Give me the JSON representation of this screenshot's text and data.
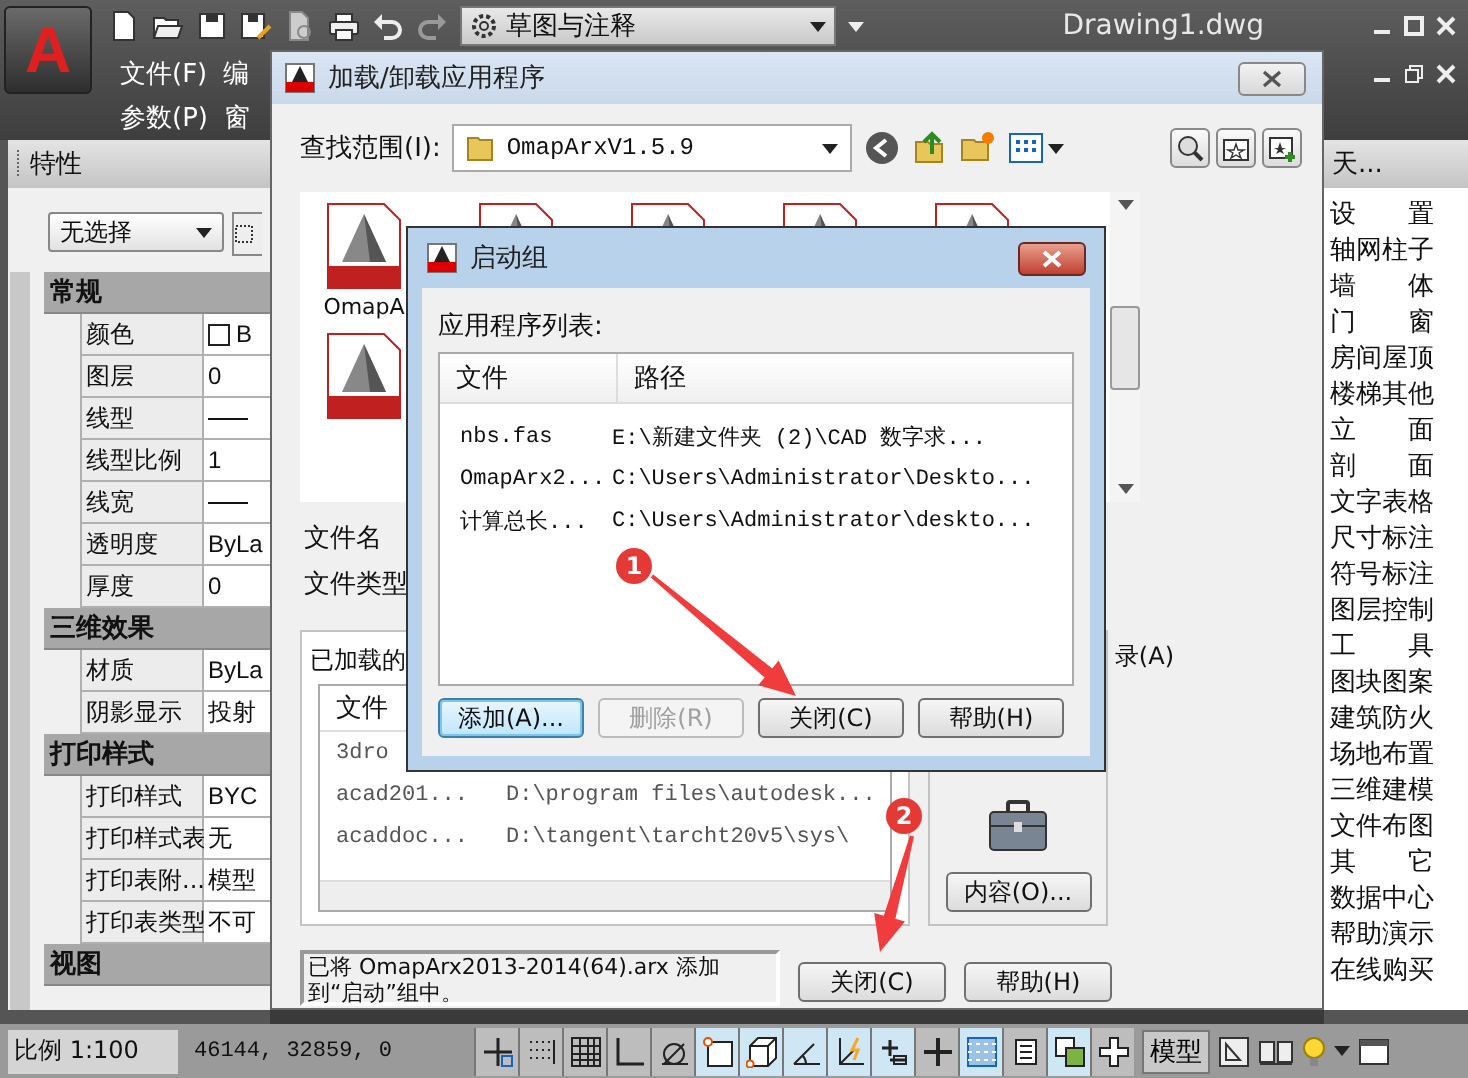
{
  "app": {
    "logo": "A",
    "title": "Drawing1.dwg",
    "workspace": "草图与注释",
    "menus": [
      [
        "文件(F)",
        "编"
      ],
      [
        "参数(P)",
        "窗"
      ]
    ]
  },
  "properties": {
    "title": "特性",
    "selection": "无选择",
    "sections": [
      {
        "title": "常规",
        "rows": [
          {
            "name": "颜色",
            "kind": "color",
            "value": "B"
          },
          {
            "name": "图层",
            "kind": "text",
            "value": "0"
          },
          {
            "name": "线型",
            "kind": "line"
          },
          {
            "name": "线型比例",
            "kind": "text",
            "value": "1"
          },
          {
            "name": "线宽",
            "kind": "line"
          },
          {
            "name": "透明度",
            "kind": "text",
            "value": "ByLa"
          },
          {
            "name": "厚度",
            "kind": "text",
            "value": "0"
          }
        ]
      },
      {
        "title": "三维效果",
        "rows": [
          {
            "name": "材质",
            "kind": "text",
            "value": "ByLa"
          },
          {
            "name": "阴影显示",
            "kind": "text",
            "value": "投射"
          }
        ]
      },
      {
        "title": "打印样式",
        "rows": [
          {
            "name": "打印样式",
            "kind": "text",
            "value": "BYC"
          },
          {
            "name": "打印样式表",
            "kind": "text",
            "value": "无"
          },
          {
            "name": "打印表附...",
            "kind": "text",
            "value": "模型"
          },
          {
            "name": "打印表类型",
            "kind": "text",
            "value": "不可"
          }
        ]
      },
      {
        "title": "视图"
      }
    ]
  },
  "tool_palette": {
    "title": "天...",
    "items": [
      "设置",
      "轴网柱子",
      "墙体",
      "门窗",
      "房间屋顶",
      "楼梯其他",
      "立面",
      "剖面",
      "文字表格",
      "尺寸标注",
      "符号标注",
      "图层控制",
      "工具",
      "图块图案",
      "建筑防火",
      "场地布置",
      "三维建模",
      "文件布图",
      "其它",
      "数据中心",
      "帮助演示",
      "在线购买"
    ]
  },
  "load_dialog": {
    "title": "加载/卸载应用程序",
    "look_in_label": "查找范围(I):",
    "look_in": "OmapArxV1.5.9",
    "files": [
      {
        "kind": "arx",
        "label": "OmapA"
      },
      {
        "kind": "arx"
      },
      {
        "kind": "arx"
      },
      {
        "kind": "arx"
      },
      {
        "kind": "arx"
      },
      {
        "kind": "arx"
      }
    ],
    "file_name_label": "文件名",
    "file_type_label": "文件类型",
    "loaded_tab": "已加载的",
    "loaded_list": {
      "columns": [
        "文件"
      ],
      "rows": [
        {
          "file": "3dro"
        },
        {
          "file": "acad201...",
          "path": "D:\\program files\\autodesk..."
        },
        {
          "file": "acaddoc...",
          "path": "D:\\tangent\\tarcht20v5\\sys\\"
        }
      ]
    },
    "startup_label": "录(A)",
    "contents_button": "内容(O)...",
    "message": "已将 OmapArx2013-2014(64).arx 添加到“启动”组中。",
    "buttons": [
      "关闭(C)",
      "帮助(H)"
    ]
  },
  "startup_dialog": {
    "title": "启动组",
    "list_label": "应用程序列表:",
    "columns": [
      "文件",
      "路径"
    ],
    "rows": [
      {
        "file": "nbs.fas",
        "path": "E:\\新建文件夹 (2)\\CAD 数字求..."
      },
      {
        "file": "OmapArx2...",
        "path": "C:\\Users\\Administrator\\Deskto..."
      },
      {
        "file": "计算总长...",
        "path": "C:\\Users\\Administrator\\deskto..."
      }
    ],
    "buttons": [
      {
        "label": "添加(A)...",
        "default": true,
        "disabled": false
      },
      {
        "label": "删除(R)",
        "default": false,
        "disabled": true
      },
      {
        "label": "关闭(C)",
        "default": false,
        "disabled": false
      },
      {
        "label": "帮助(H)",
        "default": false,
        "disabled": false
      }
    ]
  },
  "annotations": [
    {
      "label": "1"
    },
    {
      "label": "2"
    }
  ],
  "status_bar": {
    "scale": "比例 1:100",
    "coordinates": "46144, 32859, 0",
    "model": "模型",
    "toggles": [
      {
        "kind": "infer",
        "on": false
      },
      {
        "kind": "snap",
        "on": false
      },
      {
        "kind": "grid",
        "on": false
      },
      {
        "kind": "ortho",
        "on": false
      },
      {
        "kind": "polar",
        "on": false
      },
      {
        "kind": "osnap",
        "on": true
      },
      {
        "kind": "osnap3d",
        "on": true
      },
      {
        "kind": "otrack",
        "on": true
      },
      {
        "kind": "ducs",
        "on": true
      },
      {
        "kind": "dyn",
        "on": true
      },
      {
        "kind": "lwt",
        "on": false
      },
      {
        "kind": "transparency",
        "on": true
      },
      {
        "kind": "qp",
        "on": false
      },
      {
        "kind": "cycling",
        "on": true
      },
      {
        "kind": "plus",
        "on": false
      }
    ]
  }
}
